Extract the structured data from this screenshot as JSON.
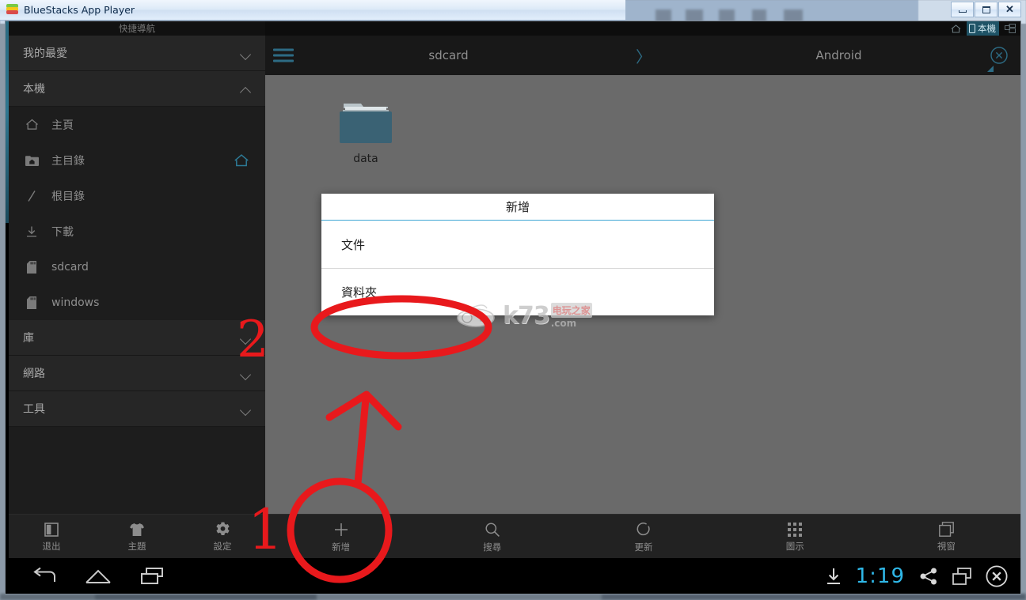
{
  "window": {
    "title": "BlueStacks App Player",
    "buttons": {
      "minimize": "minimize",
      "maximize": "maximize",
      "close": "close"
    }
  },
  "sidebar": {
    "quicknav_label": "快捷導航",
    "sections": [
      {
        "label": "我的最愛",
        "state": "collapsed"
      },
      {
        "label": "本機",
        "state": "expanded"
      }
    ],
    "items": [
      {
        "label": "主頁",
        "icon": "home-icon"
      },
      {
        "label": "主目錄",
        "icon": "folder-home-icon",
        "trailing_icon": "home-outline-icon"
      },
      {
        "label": "根目錄",
        "icon": "slash-icon"
      },
      {
        "label": "下載",
        "icon": "download-icon"
      },
      {
        "label": "sdcard",
        "icon": "sdcard-icon"
      },
      {
        "label": "windows",
        "icon": "sdcard-icon"
      }
    ],
    "sections_bottom": [
      {
        "label": "庫",
        "state": "collapsed"
      },
      {
        "label": "網路",
        "state": "collapsed"
      },
      {
        "label": "工具",
        "state": "collapsed"
      }
    ],
    "toolbar": [
      {
        "label": "退出",
        "icon": "exit-icon"
      },
      {
        "label": "主題",
        "icon": "theme-shirt-icon"
      },
      {
        "label": "設定",
        "icon": "gear-icon"
      }
    ]
  },
  "status_bar": {
    "home_icon": "home-icon",
    "tab_label": "本機",
    "tab_icon": "phone-icon",
    "right_icon": "multiwindow-icon"
  },
  "path_bar": {
    "menu_icon": "hamburger-icon",
    "crumbs": [
      "sdcard",
      "Android"
    ],
    "separator": "〉",
    "close_icon": "close-circle-icon"
  },
  "files": [
    {
      "name": "data",
      "type": "folder"
    }
  ],
  "dialog": {
    "title": "新增",
    "options": [
      {
        "label": "文件"
      },
      {
        "label": "資料夾"
      }
    ]
  },
  "action_bar": [
    {
      "label": "新增",
      "icon": "plus-icon"
    },
    {
      "label": "搜尋",
      "icon": "search-icon"
    },
    {
      "label": "更新",
      "icon": "refresh-icon"
    },
    {
      "label": "圖示",
      "icon": "grid-icon"
    },
    {
      "label": "視窗",
      "icon": "window-icon"
    }
  ],
  "nav_bar": {
    "back_icon": "back-arrow-icon",
    "home_icon": "home-outline-icon",
    "recents_icon": "recents-icon",
    "download_icon": "download-icon",
    "clock": "1:19",
    "share_icon": "share-icon",
    "window_icon": "window-icon",
    "close_icon": "close-circle-icon"
  },
  "watermark": {
    "brand": "k73",
    "domain": ".com",
    "cn": "电玩之家",
    "gamepad_icon": "gamepad-icon"
  },
  "annotations": {
    "step_one": "1",
    "step_two": "2",
    "accent_color": "#e8191c"
  },
  "colors": {
    "accent_teal": "#2d6b84",
    "clock_blue": "#2fb8e8",
    "folder_teal": "#3a6274",
    "annotation_red": "#e8191c",
    "content_bg": "#6a6a6a",
    "sidebar_bg": "#1d1d1d"
  }
}
